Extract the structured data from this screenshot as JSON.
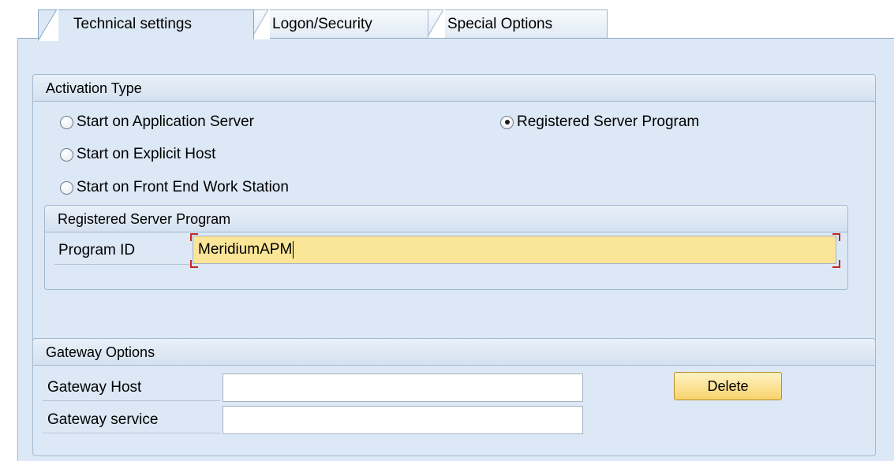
{
  "tabs": [
    {
      "label": "Technical settings",
      "active": true
    },
    {
      "label": "Logon/Security",
      "active": false
    },
    {
      "label": "Special Options",
      "active": false
    }
  ],
  "activation_type": {
    "title": "Activation Type",
    "options": [
      {
        "label": "Start on Application Server",
        "checked": false
      },
      {
        "label": "Start on Explicit Host",
        "checked": false
      },
      {
        "label": "Start on Front End Work Station",
        "checked": false
      },
      {
        "label": "Registered Server Program",
        "checked": true
      }
    ],
    "registered_server_program": {
      "title": "Registered Server Program",
      "program_id_label": "Program ID",
      "program_id_value": "MeridiumAPM"
    }
  },
  "gateway_options": {
    "title": "Gateway Options",
    "host_label": "Gateway Host",
    "host_value": "",
    "service_label": "Gateway service",
    "service_value": "",
    "delete_label": "Delete"
  },
  "colors": {
    "panel_bg": "#dce8f5",
    "required_field": "#fbe597",
    "button": "#f8d36c"
  }
}
